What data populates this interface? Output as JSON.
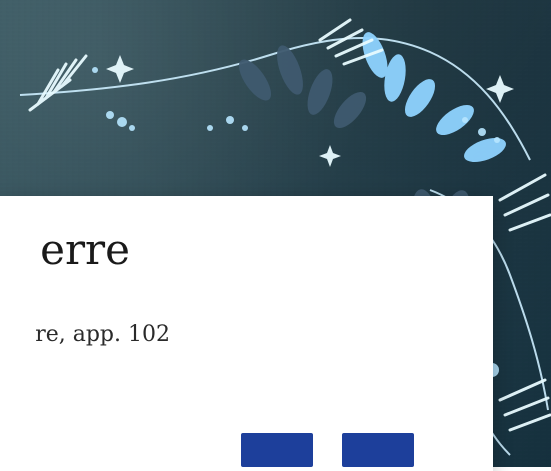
{
  "card": {
    "title": "erre",
    "subtitle": "re, app. 102"
  },
  "buttons": [
    {
      "label": ""
    },
    {
      "label": ""
    }
  ],
  "colors": {
    "background": "#2f4b55",
    "card": "#ffffff",
    "button": "#1d3f9b",
    "decor_light": "#8fd3ff",
    "decor_dark": "#3f5a6f"
  }
}
